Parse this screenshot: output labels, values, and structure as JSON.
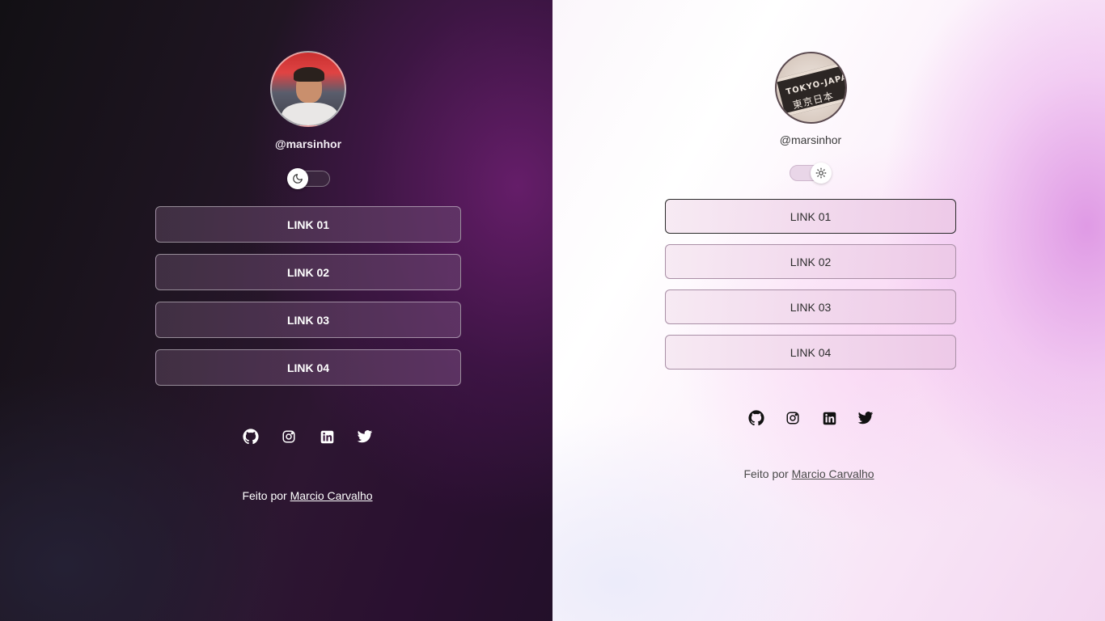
{
  "dark": {
    "username": "@marsinhor",
    "links": [
      {
        "label": "LINK 01"
      },
      {
        "label": "LINK 02"
      },
      {
        "label": "LINK 03"
      },
      {
        "label": "LINK 04"
      }
    ],
    "footer_prefix": "Feito por ",
    "footer_author": "Marcio Carvalho",
    "toggle_icon": "moon-icon",
    "socials": [
      "github-icon",
      "instagram-icon",
      "linkedin-icon",
      "twitter-icon"
    ],
    "accent": "#4e1b55"
  },
  "light": {
    "username": "@marsinhor",
    "links": [
      {
        "label": "LINK 01"
      },
      {
        "label": "LINK 02"
      },
      {
        "label": "LINK 03"
      },
      {
        "label": "LINK 04"
      }
    ],
    "footer_prefix": "Feito por ",
    "footer_author": "Marcio Carvalho",
    "toggle_icon": "sun-icon",
    "socials": [
      "github-icon",
      "instagram-icon",
      "linkedin-icon",
      "twitter-icon"
    ],
    "accent": "#e3a6e6"
  }
}
